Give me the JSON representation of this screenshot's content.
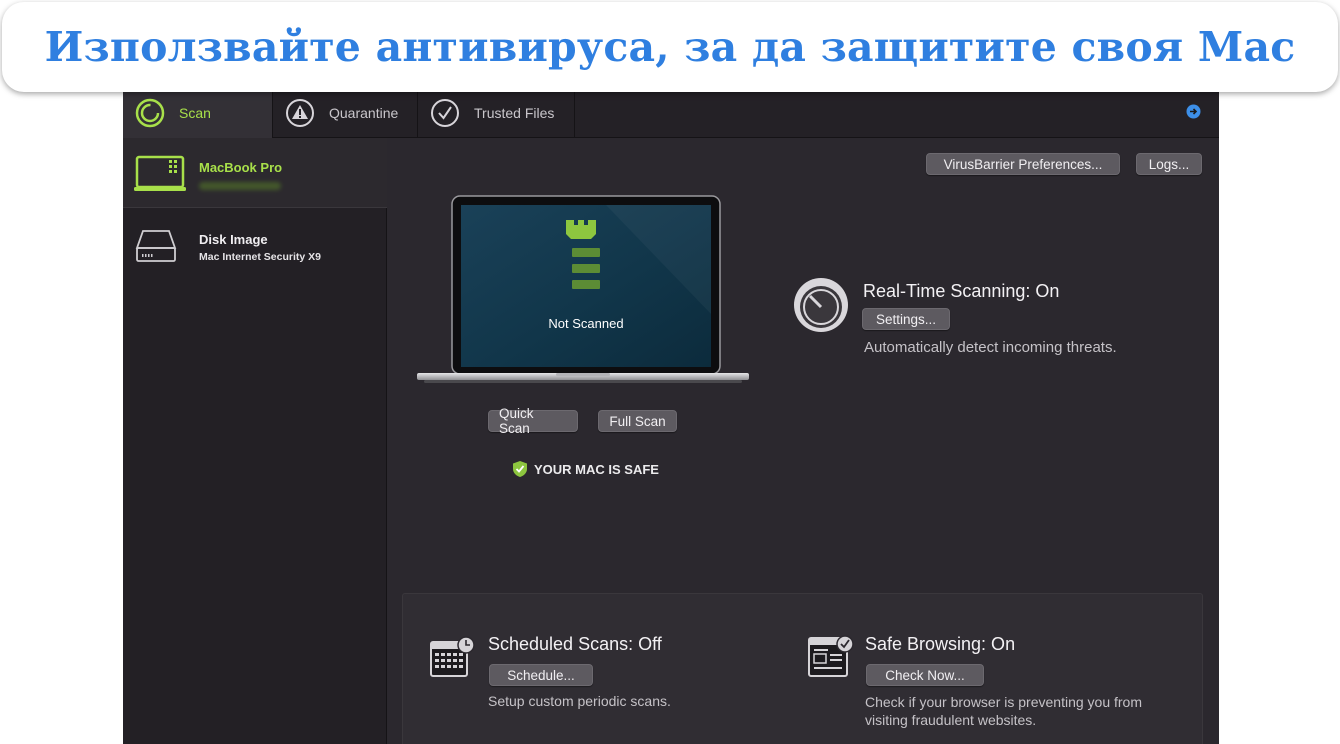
{
  "banner": {
    "title": "Използвайте антивируса, за да защитите своя Mac"
  },
  "toolbar": {
    "tabs": [
      {
        "label": "Scan",
        "icon": "scan-icon"
      },
      {
        "label": "Quarantine",
        "icon": "warning-icon"
      },
      {
        "label": "Trusted Files",
        "icon": "checkmark-icon"
      }
    ],
    "help_icon": "arrow-right-circle-icon"
  },
  "sidebar": {
    "devices": [
      {
        "name": "MacBook Pro",
        "icon": "laptop-icon"
      },
      {
        "name": "Disk Image",
        "subtitle": "Mac Internet Security X9",
        "icon": "disk-drive-icon"
      }
    ]
  },
  "main": {
    "prefs_button": "VirusBarrier Preferences...",
    "logs_button": "Logs...",
    "scan_status": "Not Scanned",
    "quick_scan_button": "Quick Scan",
    "full_scan_button": "Full Scan",
    "safe_status": "YOUR MAC IS SAFE",
    "realtime": {
      "title": "Real-Time Scanning: On",
      "settings_button": "Settings...",
      "description": "Automatically detect incoming threats."
    },
    "scheduled": {
      "title": "Scheduled Scans: Off",
      "button": "Schedule...",
      "description": "Setup custom periodic scans."
    },
    "safe_browsing": {
      "title": "Safe Browsing: On",
      "button": "Check Now...",
      "description": "Check if your browser is preventing you from visiting fraudulent websites."
    }
  },
  "colors": {
    "accent_green": "#a8e04a",
    "banner_blue": "#2f7fe0",
    "app_bg": "#2b282e"
  }
}
